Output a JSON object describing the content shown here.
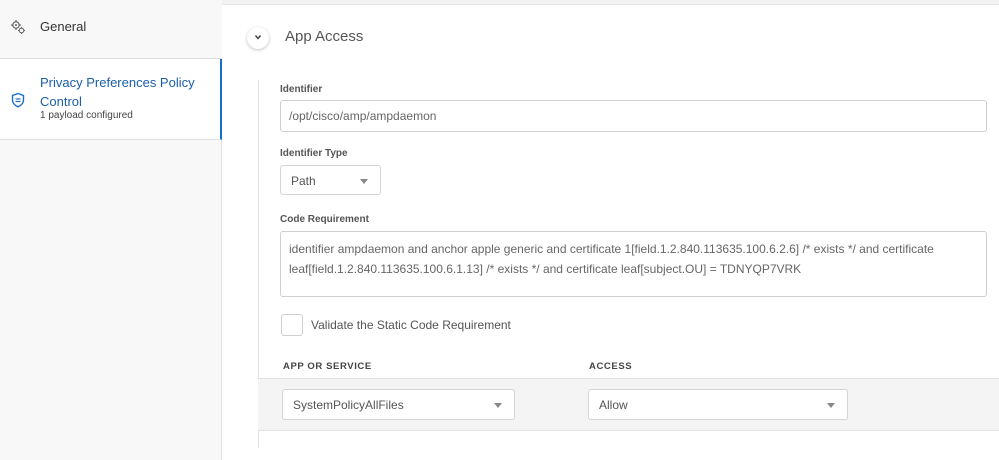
{
  "sidebar": {
    "items": [
      {
        "title": "General",
        "icon": "gears-icon"
      },
      {
        "title": "Privacy Preferences Policy Control",
        "subtitle": "1 payload configured",
        "icon": "shield-icon",
        "active": true
      }
    ]
  },
  "section": {
    "title": "App Access",
    "expanded": true
  },
  "form": {
    "identifier_label": "Identifier",
    "identifier_value": "/opt/cisco/amp/ampdaemon",
    "identifier_type_label": "Identifier Type",
    "identifier_type_value": "Path",
    "code_requirement_label": "Code Requirement",
    "code_requirement_value": "identifier ampdaemon and anchor apple generic and certificate 1[field.1.2.840.113635.100.6.2.6] /* exists */ and certificate leaf[field.1.2.840.113635.100.6.1.13] /* exists */ and certificate leaf[subject.OU] = TDNYQP7VRK",
    "validate_label": "Validate the Static Code Requirement",
    "validate_checked": false
  },
  "table": {
    "columns": [
      "APP OR SERVICE",
      "ACCESS"
    ],
    "rows": [
      {
        "service": "SystemPolicyAllFiles",
        "access": "Allow"
      }
    ]
  },
  "colors": {
    "accent": "#1a6ec7",
    "sidebar_bg": "#f8f8f8",
    "row_bg": "#f4f4f4"
  }
}
